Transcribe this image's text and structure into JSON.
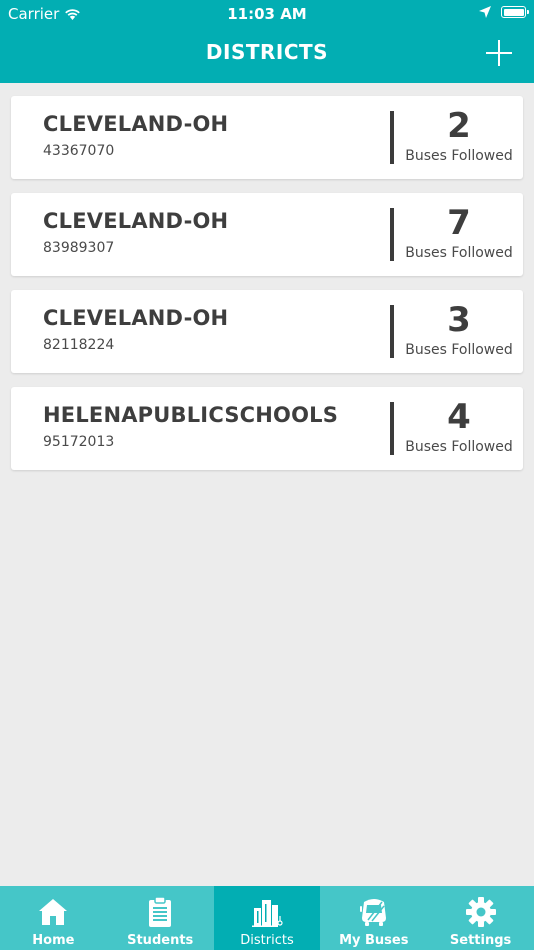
{
  "status_bar": {
    "carrier": "Carrier",
    "time": "11:03 AM"
  },
  "header": {
    "title": "DISTRICTS"
  },
  "districts": [
    {
      "name": "CLEVELAND-OH",
      "code": "43367070",
      "count": "2",
      "count_label": "Buses Followed"
    },
    {
      "name": "CLEVELAND-OH",
      "code": "83989307",
      "count": "7",
      "count_label": "Buses Followed"
    },
    {
      "name": "CLEVELAND-OH",
      "code": "82118224",
      "count": "3",
      "count_label": "Buses Followed"
    },
    {
      "name": "HELENAPUBLICSCHOOLS",
      "code": "95172013",
      "count": "4",
      "count_label": "Buses Followed"
    }
  ],
  "tabs": [
    {
      "label": "Home",
      "icon": "home-icon"
    },
    {
      "label": "Students",
      "icon": "clipboard-icon"
    },
    {
      "label": "Districts",
      "icon": "buildings-icon"
    },
    {
      "label": "My Buses",
      "icon": "bus-icon"
    },
    {
      "label": "Settings",
      "icon": "gear-icon"
    }
  ],
  "active_tab": "Districts",
  "colors": {
    "brand": "#02aeb3",
    "tabbar": "#45c6c8",
    "background": "#ececec"
  }
}
